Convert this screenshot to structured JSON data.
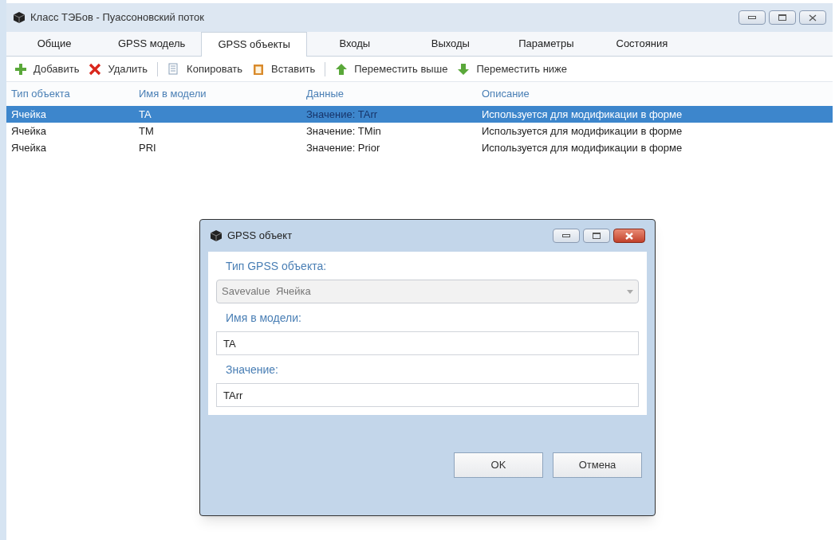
{
  "window": {
    "title": "Класс ТЭБов - Пуассоновский поток"
  },
  "tabs": [
    {
      "label": "Общие",
      "selected": false
    },
    {
      "label": "GPSS модель",
      "selected": false
    },
    {
      "label": "GPSS объекты",
      "selected": true
    },
    {
      "label": "Входы",
      "selected": false
    },
    {
      "label": "Выходы",
      "selected": false
    },
    {
      "label": "Параметры",
      "selected": false
    },
    {
      "label": "Состояния",
      "selected": false
    }
  ],
  "toolbar": [
    [
      {
        "kind": "add",
        "label": "Добавить"
      },
      {
        "kind": "delete",
        "label": "Удалить"
      }
    ],
    [
      {
        "kind": "copy",
        "label": "Копировать"
      },
      {
        "kind": "paste",
        "label": "Вставить"
      }
    ],
    [
      {
        "kind": "up",
        "label": "Переместить выше"
      },
      {
        "kind": "down",
        "label": "Переместить ниже"
      }
    ]
  ],
  "table": {
    "columns": [
      "Тип объекта",
      "Имя в модели",
      "Данные",
      "Описание"
    ],
    "rows": [
      {
        "selected": true,
        "cells": [
          "Ячейка",
          "TA",
          "Значение: TArr",
          "Используется для модификации в форме"
        ]
      },
      {
        "selected": false,
        "cells": [
          "Ячейка",
          "TM",
          "Значение: TMin",
          "Используется для модификации в форме"
        ]
      },
      {
        "selected": false,
        "cells": [
          "Ячейка",
          "PRI",
          "Значение: Prior",
          "Используется для модификации в форме"
        ]
      }
    ]
  },
  "dialog": {
    "title": "GPSS объект",
    "fields": [
      {
        "kind": "combo",
        "label": "Тип GPSS объекта:",
        "value": "Savevalue  Ячейка",
        "disabled": true
      },
      {
        "kind": "text",
        "label": "Имя в модели:",
        "value": "TA"
      },
      {
        "kind": "text",
        "label": "Значение:",
        "value": "TArr"
      }
    ],
    "buttons": [
      "OK",
      "Отмена"
    ]
  }
}
